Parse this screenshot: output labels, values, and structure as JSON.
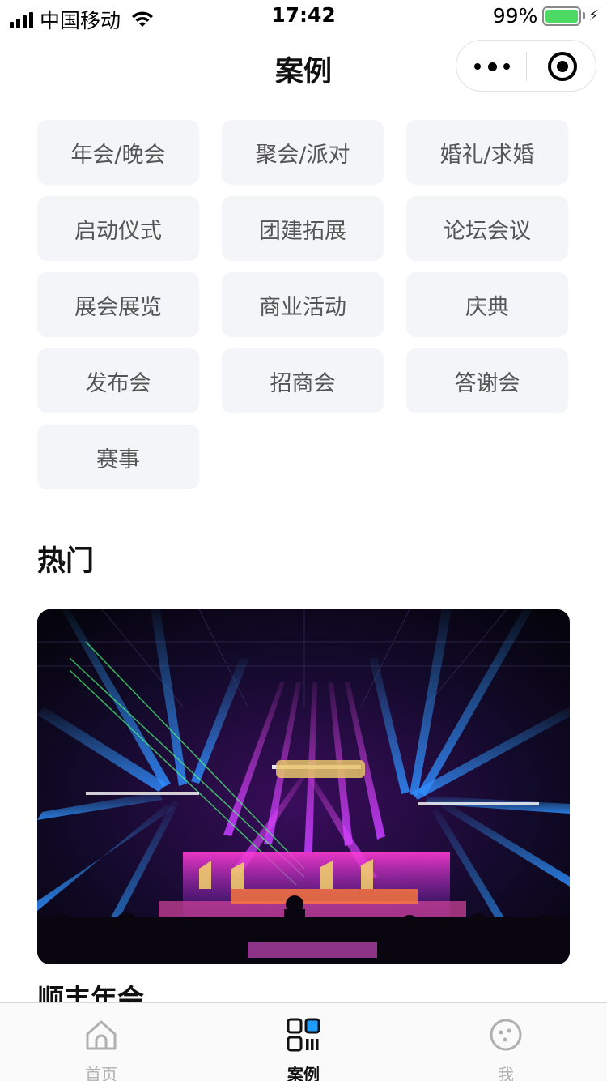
{
  "status_bar": {
    "carrier": "中国移动",
    "time": "17:42",
    "battery": "99%",
    "battery_level": 0.99
  },
  "nav": {
    "title": "案例"
  },
  "categories": [
    "年会/晚会",
    "聚会/派对",
    "婚礼/求婚",
    "启动仪式",
    "团建拓展",
    "论坛会议",
    "展会展览",
    "商业活动",
    "庆典",
    "发布会",
    "招商会",
    "答谢会",
    "赛事"
  ],
  "hot": {
    "title": "热门",
    "cards": [
      {
        "title": "顺丰年会"
      }
    ]
  },
  "tabbar": {
    "items": [
      {
        "label": "首页",
        "icon": "home-icon",
        "active": false
      },
      {
        "label": "案例",
        "icon": "grid-icon",
        "active": true
      },
      {
        "label": "我",
        "icon": "face-icon",
        "active": false
      }
    ]
  },
  "colors": {
    "battery_green": "#4cd964",
    "category_bg": "#f4f5f8",
    "tab_active": "#111111",
    "tab_inactive": "#b0b0b0",
    "accent_blue": "#1e9bff"
  }
}
